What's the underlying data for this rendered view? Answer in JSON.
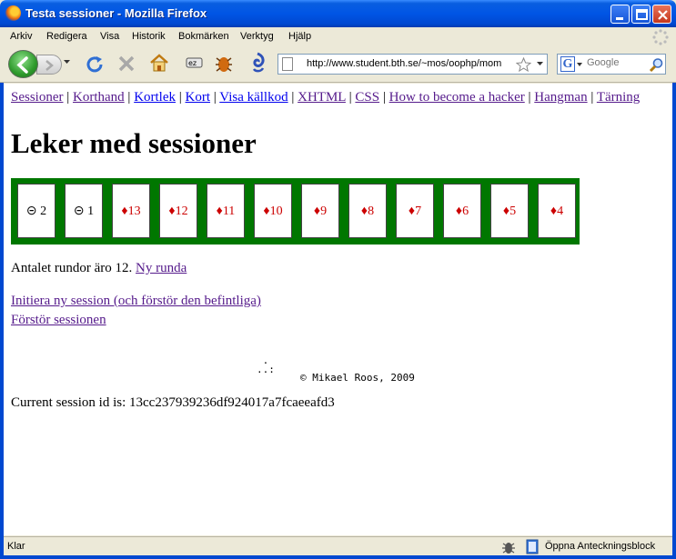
{
  "window": {
    "title": "Testa sessioner - Mozilla Firefox"
  },
  "menu": [
    "Arkiv",
    "Redigera",
    "Visa",
    "Historik",
    "Bokmärken",
    "Verktyg",
    "Hjälp"
  ],
  "toolbar": {
    "url": "http://www.student.bth.se/~mos/oophp/mom",
    "search_placeholder": "Google"
  },
  "page": {
    "nav": [
      "Sessioner",
      "Korthand",
      "Kortlek",
      "Kort",
      "Visa källkod",
      "XHTML",
      "CSS",
      "How to become a hacker",
      "Hangman",
      "Tärning"
    ],
    "heading": "Leker med sessioner",
    "cards": [
      {
        "suit": "⊝",
        "rank": "2",
        "color": "black"
      },
      {
        "suit": "⊝",
        "rank": "1",
        "color": "black"
      },
      {
        "suit": "♦",
        "rank": "13",
        "color": "red"
      },
      {
        "suit": "♦",
        "rank": "12",
        "color": "red"
      },
      {
        "suit": "♦",
        "rank": "11",
        "color": "red"
      },
      {
        "suit": "♦",
        "rank": "10",
        "color": "red"
      },
      {
        "suit": "♦",
        "rank": "9",
        "color": "red"
      },
      {
        "suit": "♦",
        "rank": "8",
        "color": "red"
      },
      {
        "suit": "♦",
        "rank": "7",
        "color": "red"
      },
      {
        "suit": "♦",
        "rank": "6",
        "color": "red"
      },
      {
        "suit": "♦",
        "rank": "5",
        "color": "red"
      },
      {
        "suit": "♦",
        "rank": "4",
        "color": "red"
      }
    ],
    "rounds_text": "Antalet rundor äro 12.",
    "new_round_link": "Ny runda",
    "init_session_link": "Initiera ny session (och förstör den befintliga)",
    "destroy_session_link": "Förstör sessionen",
    "footer_dots": " .\n..:",
    "footer_copyright": "© Mikael Roos, 2009",
    "session_id_text": "Current session id is: 13cc237939236df924017a7fcaeeafd3"
  },
  "statusbar": {
    "status": "Klar",
    "notepad": "Öppna Anteckningsblock"
  },
  "colors": {
    "card_table": "#007700",
    "visited_link": "#551a8b",
    "titlebar": "#0055e5"
  }
}
